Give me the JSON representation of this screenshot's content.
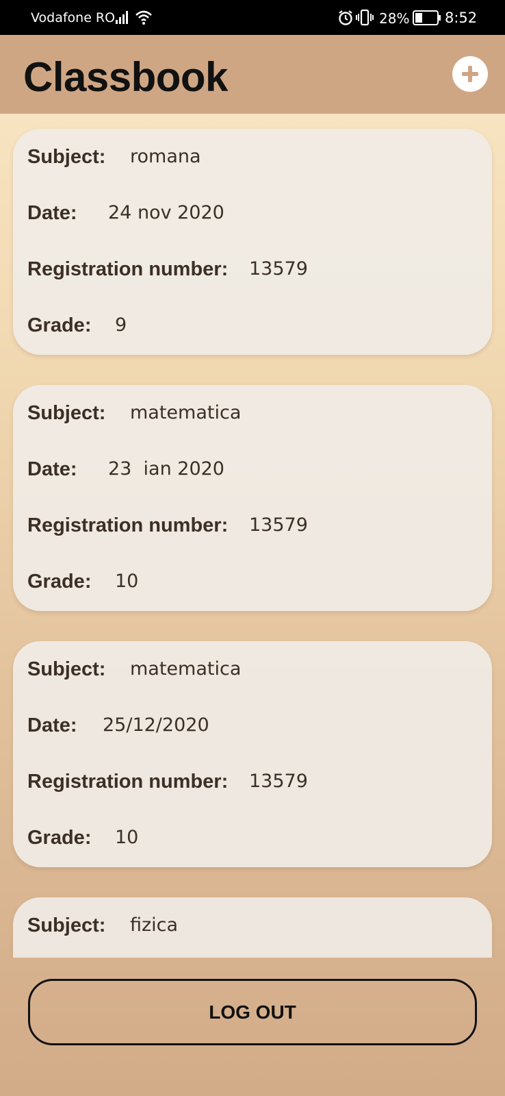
{
  "status_bar": {
    "carrier": "Vodafone RO",
    "battery_percent": "28%",
    "time": "8:52",
    "icons": [
      "signal-icon",
      "wifi-icon",
      "alarm-icon",
      "vibrate-icon",
      "battery-icon"
    ]
  },
  "app_bar": {
    "title": "Classbook",
    "add_icon": "plus-circle-icon"
  },
  "labels": {
    "subject": "Subject:",
    "date": "Date:",
    "registration_number": "Registration number:",
    "grade": "Grade:"
  },
  "grades": [
    {
      "subject": "romana",
      "date": "24 nov 2020",
      "registration_number": "13579",
      "grade": "9"
    },
    {
      "subject": "matematica",
      "date": "23  ian 2020",
      "registration_number": "13579",
      "grade": "10"
    },
    {
      "subject": "matematica",
      "date": "25/12/2020",
      "registration_number": "13579",
      "grade": "10"
    },
    {
      "subject": "fizica"
    }
  ],
  "logout_label": "LOG OUT",
  "colors": {
    "app_bar": "#cfa684",
    "card": "#f0ece6",
    "text": "#3b2f26"
  }
}
